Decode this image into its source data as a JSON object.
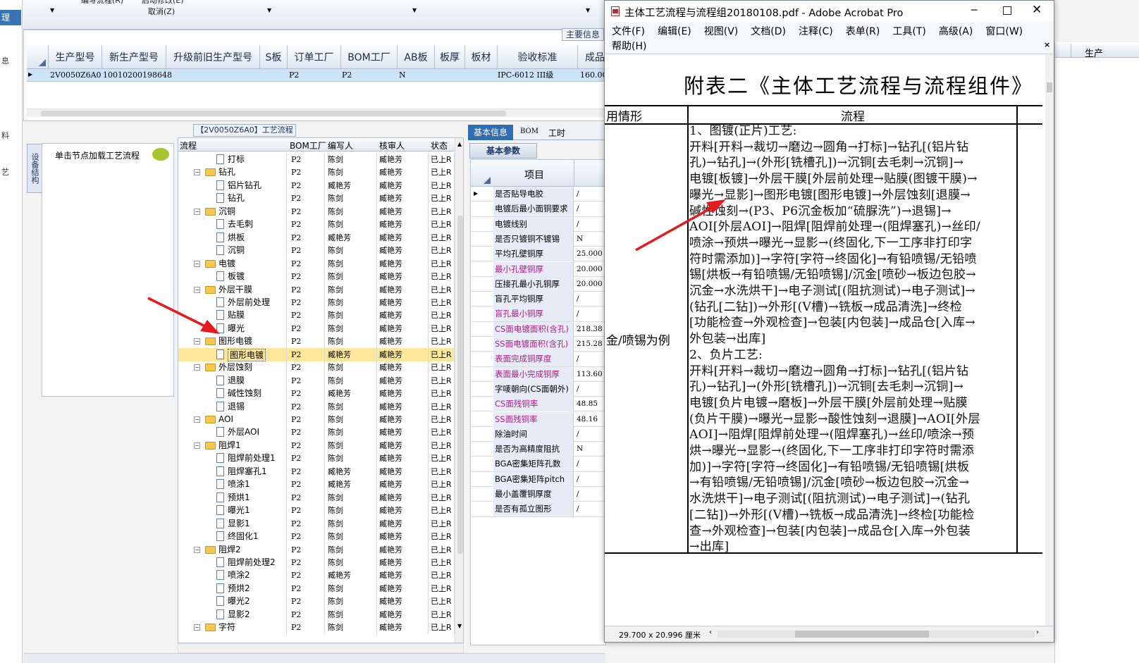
{
  "top_toolbar": {
    "partial_label_1": "编写流程(R)",
    "partial_label_2": "启动修改(E)",
    "cancel_label": "取消(Z)"
  },
  "left_strip": {
    "chars": [
      "理",
      "息",
      "料",
      "艺"
    ]
  },
  "main_grid": {
    "tab_label": "主要信息",
    "headers": [
      "生产型号",
      "新生产型号",
      "升级前旧生产型号",
      "S板",
      "订单工厂",
      "BOM工厂",
      "AB板",
      "板厚",
      "板材",
      "验收标准",
      "成品"
    ],
    "row": {
      "values": [
        "2V0050Z6A0",
        "10010200198648",
        "",
        "",
        "P2",
        "P2",
        "N",
        "",
        "",
        "IPC-6012 III级",
        "160.00"
      ]
    },
    "right_col_label": "生产"
  },
  "structure_tab": {
    "label": "设备结构",
    "hint": "单击节点加载工艺流程"
  },
  "flow_panel": {
    "title": "【2V0050Z6A0】工艺流程",
    "headers": [
      "流程",
      "BOM工厂",
      "编写人",
      "核审人",
      "状态"
    ],
    "rows": [
      {
        "name": "打标",
        "folder": false,
        "bom": "P2",
        "writer": "陈剑",
        "reviewer": "臧艳芳",
        "status": "已上R"
      },
      {
        "name": "钻孔",
        "folder": true,
        "bom": "P2",
        "writer": "陈剑",
        "reviewer": "臧艳芳",
        "status": "已上R"
      },
      {
        "name": "铝片钻孔",
        "folder": false,
        "bom": "P2",
        "writer": "臧艳芳",
        "reviewer": "臧艳芳",
        "status": "已上R"
      },
      {
        "name": "钻孔",
        "folder": false,
        "bom": "P2",
        "writer": "陈剑",
        "reviewer": "臧艳芳",
        "status": "已上R"
      },
      {
        "name": "沉铜",
        "folder": true,
        "bom": "P2",
        "writer": "陈剑",
        "reviewer": "臧艳芳",
        "status": "已上R"
      },
      {
        "name": "去毛刺",
        "folder": false,
        "bom": "P2",
        "writer": "陈剑",
        "reviewer": "臧艳芳",
        "status": "已上R"
      },
      {
        "name": "烘板",
        "folder": false,
        "bom": "P2",
        "writer": "臧艳芳",
        "reviewer": "臧艳芳",
        "status": "已上R"
      },
      {
        "name": "沉铜",
        "folder": false,
        "bom": "P2",
        "writer": "陈剑",
        "reviewer": "臧艳芳",
        "status": "已上R"
      },
      {
        "name": "电镀",
        "folder": true,
        "bom": "P2",
        "writer": "陈剑",
        "reviewer": "臧艳芳",
        "status": "已上R"
      },
      {
        "name": "板镀",
        "folder": false,
        "bom": "P2",
        "writer": "陈剑",
        "reviewer": "臧艳芳",
        "status": "已上R"
      },
      {
        "name": "外层干膜",
        "folder": true,
        "bom": "P2",
        "writer": "陈剑",
        "reviewer": "臧艳芳",
        "status": "已上R"
      },
      {
        "name": "外层前处理",
        "folder": false,
        "bom": "P2",
        "writer": "陈剑",
        "reviewer": "臧艳芳",
        "status": "已上R"
      },
      {
        "name": "贴膜",
        "folder": false,
        "bom": "P2",
        "writer": "陈剑",
        "reviewer": "臧艳芳",
        "status": "已上R"
      },
      {
        "name": "曝光",
        "folder": false,
        "bom": "P2",
        "writer": "陈剑",
        "reviewer": "臧艳芳",
        "status": "已上R"
      },
      {
        "name": "图形电镀",
        "folder": true,
        "bom": "P2",
        "writer": "陈剑",
        "reviewer": "臧艳芳",
        "status": "已上R"
      },
      {
        "name": "图形电镀",
        "folder": false,
        "bom": "P2",
        "writer": "臧艳芳",
        "reviewer": "臧艳芳",
        "status": "已上R"
      },
      {
        "name": "外层蚀刻",
        "folder": true,
        "bom": "P2",
        "writer": "陈剑",
        "reviewer": "臧艳芳",
        "status": "已上R"
      },
      {
        "name": "退膜",
        "folder": false,
        "bom": "P2",
        "writer": "陈剑",
        "reviewer": "臧艳芳",
        "status": "已上R"
      },
      {
        "name": "碱性蚀刻",
        "folder": false,
        "bom": "P2",
        "writer": "臧艳芳",
        "reviewer": "臧艳芳",
        "status": "已上R"
      },
      {
        "name": "退锡",
        "folder": false,
        "bom": "P2",
        "writer": "陈剑",
        "reviewer": "臧艳芳",
        "status": "已上R"
      },
      {
        "name": "AOI",
        "folder": true,
        "bom": "P2",
        "writer": "陈剑",
        "reviewer": "臧艳芳",
        "status": "已上R"
      },
      {
        "name": "外层AOI",
        "folder": false,
        "bom": "P2",
        "writer": "陈剑",
        "reviewer": "臧艳芳",
        "status": "已上R"
      },
      {
        "name": "阻焊1",
        "folder": true,
        "bom": "P2",
        "writer": "陈剑",
        "reviewer": "臧艳芳",
        "status": "已上R"
      },
      {
        "name": "阻焊前处理1",
        "folder": false,
        "bom": "P2",
        "writer": "陈剑",
        "reviewer": "臧艳芳",
        "status": "已上R"
      },
      {
        "name": "阻焊塞孔1",
        "folder": false,
        "bom": "P2",
        "writer": "臧艳芳",
        "reviewer": "臧艳芳",
        "status": "已上R"
      },
      {
        "name": "喷涂1",
        "folder": false,
        "bom": "P2",
        "writer": "臧艳芳",
        "reviewer": "臧艳芳",
        "status": "已上R"
      },
      {
        "name": "预烘1",
        "folder": false,
        "bom": "P2",
        "writer": "陈剑",
        "reviewer": "臧艳芳",
        "status": "已上R"
      },
      {
        "name": "曝光1",
        "folder": false,
        "bom": "P2",
        "writer": "陈剑",
        "reviewer": "臧艳芳",
        "status": "已上R"
      },
      {
        "name": "显影1",
        "folder": false,
        "bom": "P2",
        "writer": "陈剑",
        "reviewer": "臧艳芳",
        "status": "已上R"
      },
      {
        "name": "终固化1",
        "folder": false,
        "bom": "P2",
        "writer": "陈剑",
        "reviewer": "臧艳芳",
        "status": "已上R"
      },
      {
        "name": "阻焊2",
        "folder": true,
        "bom": "P2",
        "writer": "陈剑",
        "reviewer": "臧艳芳",
        "status": "已上R"
      },
      {
        "name": "阻焊前处理2",
        "folder": false,
        "bom": "P2",
        "writer": "陈剑",
        "reviewer": "臧艳芳",
        "status": "已上R"
      },
      {
        "name": "喷涂2",
        "folder": false,
        "bom": "P2",
        "writer": "臧艳芳",
        "reviewer": "臧艳芳",
        "status": "已上R"
      },
      {
        "name": "预烘2",
        "folder": false,
        "bom": "P2",
        "writer": "陈剑",
        "reviewer": "臧艳芳",
        "status": "已上R"
      },
      {
        "name": "曝光2",
        "folder": false,
        "bom": "P2",
        "writer": "陈剑",
        "reviewer": "臧艳芳",
        "status": "已上R"
      },
      {
        "name": "显影2",
        "folder": false,
        "bom": "P2",
        "writer": "陈剑",
        "reviewer": "臧艳芳",
        "status": "已上R"
      },
      {
        "name": "字符",
        "folder": true,
        "bom": "P2",
        "writer": "陈剑",
        "reviewer": "臧艳芳",
        "status": "已上R"
      }
    ],
    "selected_index": 15,
    "highlight_color": "#fde79a"
  },
  "params_panel": {
    "tabs": [
      "基本信息",
      "BOM",
      "工时"
    ],
    "subtab": "基本参数",
    "col_header": "项目",
    "rows": [
      {
        "k": "是否贴导电胶",
        "v": "/",
        "pink": false
      },
      {
        "k": "电镀后最小面铜要求",
        "v": "/",
        "pink": false
      },
      {
        "k": "电镀线别",
        "v": "/",
        "pink": false
      },
      {
        "k": "是否只镀铜不镀锡",
        "v": "N",
        "pink": false
      },
      {
        "k": "平均孔壁铜厚",
        "v": "25.000",
        "pink": false
      },
      {
        "k": "最小孔壁铜厚",
        "v": "20.000",
        "pink": true
      },
      {
        "k": "压接孔最小孔铜厚",
        "v": "20.000",
        "pink": false
      },
      {
        "k": "盲孔平均铜厚",
        "v": "/",
        "pink": false
      },
      {
        "k": "盲孔最小铜厚",
        "v": "/",
        "pink": true
      },
      {
        "k": "CS面电镀面积(含孔)",
        "v": "218.38",
        "pink": true
      },
      {
        "k": "SS面电镀面积(含孔)",
        "v": "215.28",
        "pink": true
      },
      {
        "k": "表面完成铜厚度",
        "v": "/",
        "pink": true
      },
      {
        "k": "表面最小完成铜厚",
        "v": "113.60",
        "pink": true
      },
      {
        "k": "字唛朝向(CS面朝外)",
        "v": "/",
        "pink": false
      },
      {
        "k": "CS面残铜率",
        "v": "48.85",
        "pink": true
      },
      {
        "k": "SS面残铜率",
        "v": "48.16",
        "pink": true
      },
      {
        "k": "除油时间",
        "v": "/",
        "pink": false
      },
      {
        "k": "是否为高精度阻抗",
        "v": "N",
        "pink": false
      },
      {
        "k": "BGA密集矩阵孔数",
        "v": "/",
        "pink": false
      },
      {
        "k": "BGA密集矩阵pitch",
        "v": "/",
        "pink": false
      },
      {
        "k": "最小盖覆铜厚度",
        "v": "/",
        "pink": false
      },
      {
        "k": "是否有孤立图形",
        "v": "/",
        "pink": false
      }
    ]
  },
  "acrobat": {
    "title": "主体工艺流程与流程组20180108.pdf - Adobe Acrobat Pro",
    "menu": [
      "文件(F)",
      "编辑(E)",
      "视图(V)",
      "文档(D)",
      "注释(C)",
      "表单(R)",
      "工具(T)",
      "高级(A)",
      "窗口(W)"
    ],
    "menu_help": "帮助(H)",
    "doc_heading": "附表二《主体工艺流程与流程组件》",
    "col_left": "用情形",
    "col_right": "流程",
    "left_cell": "金/喷锡为例",
    "flow_lines": [
      "1、图镀(正片)工艺:",
      "开料[开料→裁切→磨边→圆角→打标]→钻孔[(铝片钻",
      "孔)→钻孔]→(外形[铣槽孔])→沉铜[去毛刺→沉铜]→",
      "电镀[板镀]→外层干膜[外层前处理→贴膜(图镀干膜)→",
      "曝光→显影]→图形电镀[图形电镀]→外层蚀刻[退膜→",
      "碱性蚀刻→(P3、P6沉金板加“硫脲洗”)→退锡]→",
      "AOI[外层AOI]→阻焊[阻焊前处理→(阻焊塞孔)→丝印/",
      "喷涂→预烘→曝光→显影→(终固化,下一工序非打印字",
      "符时需添加)]→字符[字符→终固化]→有铅喷锡/无铅喷",
      "锡[烘板→有铅喷锡/无铅喷锡]/沉金[喷砂→板边包胶→",
      "沉金→水洗烘干]→电子测试[(阻抗测试)→电子测试]→",
      "(钻孔[二钻])→外形[(V槽)→铣板→成品清洗]→终检",
      "[功能检查→外观检查]→包装[内包装]→成品仓[入库→",
      "外包装→出库]",
      "2、负片工艺:",
      "开料[开料→裁切→磨边→圆角→打标]→钻孔[(铝片钻",
      "孔)→钻孔]→(外形[铣槽孔])→沉铜[去毛刺→沉铜]→",
      "电镀[负片电镀→磨板]→外层干膜[外层前处理→贴膜",
      "(负片干膜)→曝光→显影→酸性蚀刻→退膜]→AOI[外层",
      "AOI]→阻焊[阻焊前处理→(阻焊塞孔)→丝印/喷涂→预",
      "烘→曝光→显影→(终固化,下一工序非打印字符时需添",
      "加)]→字符[字符→终固化]→有铅喷锡/无铅喷锡[烘板",
      "→有铅喷锡/无铅喷锡]/沉金[喷砂→板边包胶→沉金→",
      "水洗烘干]→电子测试[(阻抗测试)→电子测试]→(钻孔",
      "[二钻])→外形[(V槽)→铣板→成品清洗]→终检[功能检",
      "查→外观检查]→包装[内包装]→成品仓[入库→外包装",
      "→出库]"
    ],
    "page_size": "29.700 x 20.996 厘米"
  },
  "colors": {
    "arrow": "#e8191d",
    "pink_text": "#b0208a",
    "selection": "#cde3f7",
    "title_blue": "#2b5797"
  }
}
